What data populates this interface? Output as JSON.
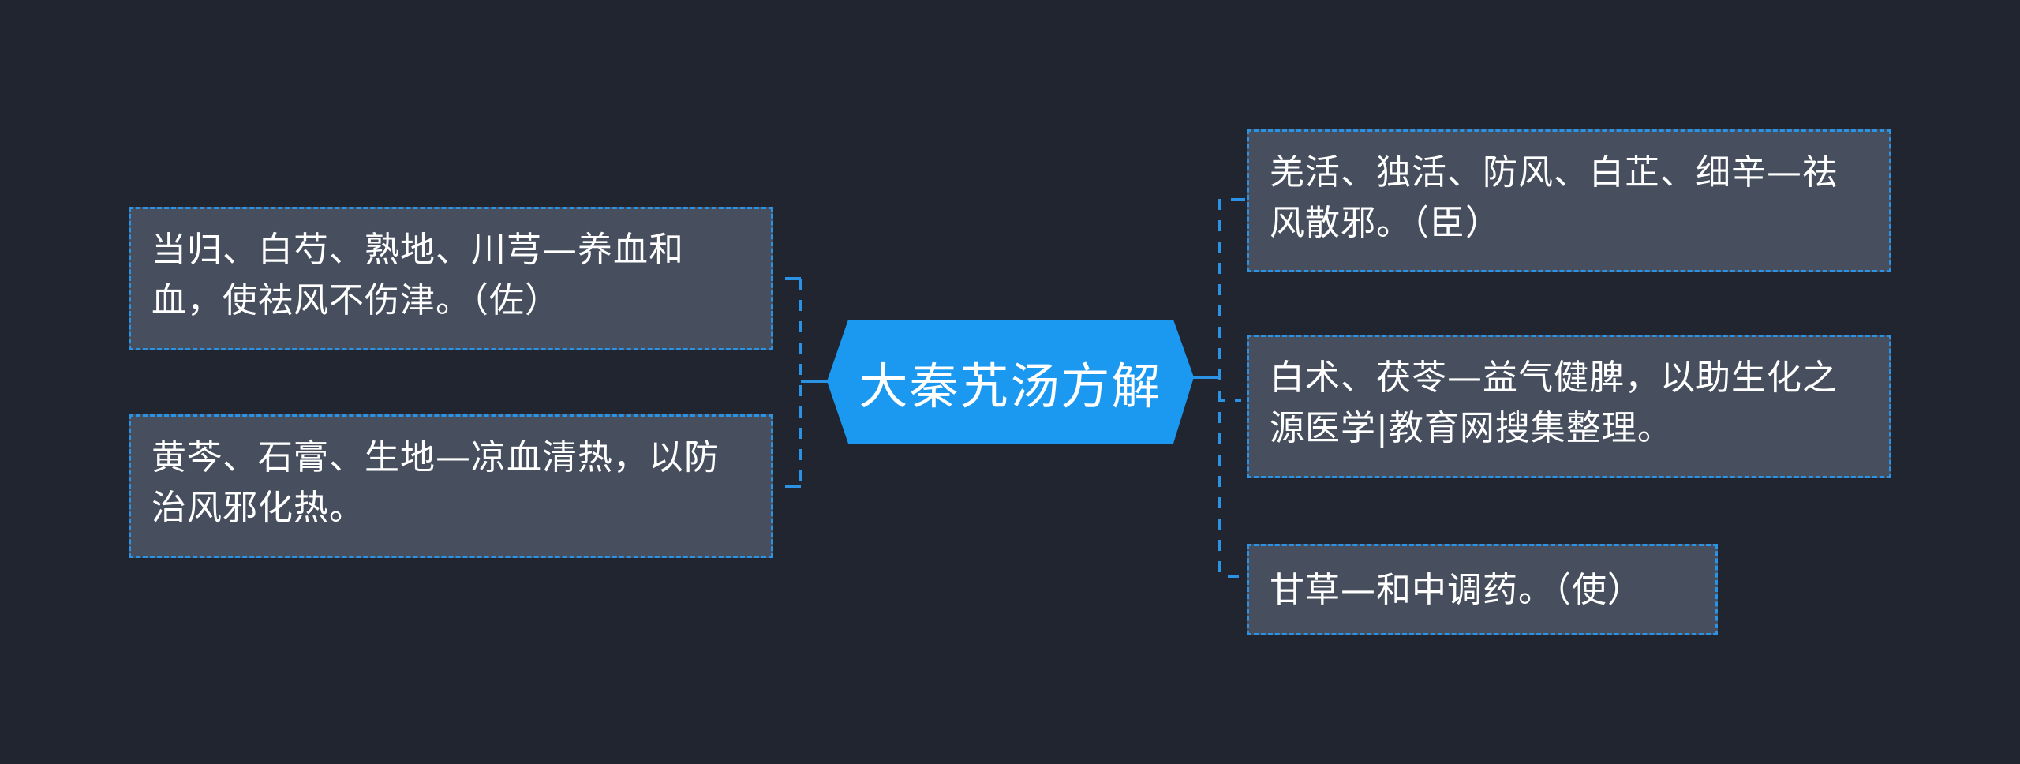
{
  "title": "大秦艽汤方解",
  "colors": {
    "background": "#21252f",
    "root_fill": "#1b98f0",
    "node_fill": "#474f5e",
    "connector": "#2a93e6",
    "text": "#ffffff"
  },
  "left_nodes": [
    {
      "text": "当归、白芍、熟地、川芎—养血和血，使祛风不伤津。（佐）"
    },
    {
      "text": "黄芩、石膏、生地—凉血清热，以防治风邪化热。"
    }
  ],
  "right_nodes": [
    {
      "text": "羌活、独活、防风、白芷、细辛—祛风散邪。（臣）"
    },
    {
      "text": "白术、茯苓—益气健脾，以助生化之源医学|教育网搜集整理。"
    },
    {
      "text": "甘草—和中调药。（使）"
    }
  ]
}
